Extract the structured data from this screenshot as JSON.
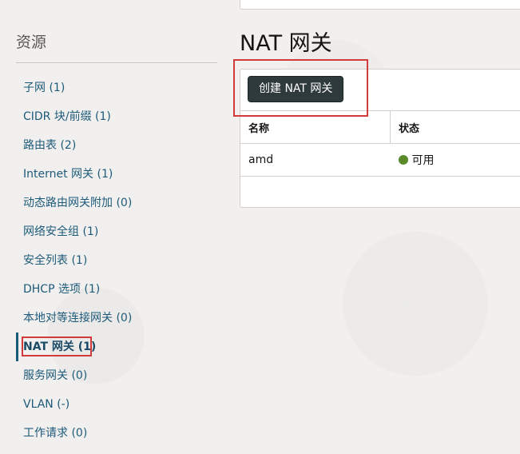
{
  "sidebar": {
    "title": "资源",
    "items": [
      {
        "label": "子网 (1)"
      },
      {
        "label": "CIDR 块/前缀 (1)"
      },
      {
        "label": "路由表 (2)"
      },
      {
        "label": "Internet 网关 (1)"
      },
      {
        "label": "动态路由网关附加 (0)"
      },
      {
        "label": "网络安全组 (1)"
      },
      {
        "label": "安全列表 (1)"
      },
      {
        "label": "DHCP 选项 (1)"
      },
      {
        "label": "本地对等连接网关 (0)"
      },
      {
        "label": "NAT 网关 (1)",
        "active": true
      },
      {
        "label": "服务网关 (0)"
      },
      {
        "label": "VLAN (-)"
      },
      {
        "label": "工作请求 (0)"
      }
    ]
  },
  "main": {
    "title": "NAT 网关",
    "create_button": "创建 NAT 网关",
    "table": {
      "columns": [
        "名称",
        "状态"
      ],
      "rows": [
        {
          "name": "amd",
          "status": "可用",
          "status_color": "#5a8a2a"
        }
      ]
    }
  },
  "colors": {
    "accent": "#1b5a7a",
    "highlight": "#d13b3b",
    "button_bg": "#2f3a3c"
  }
}
